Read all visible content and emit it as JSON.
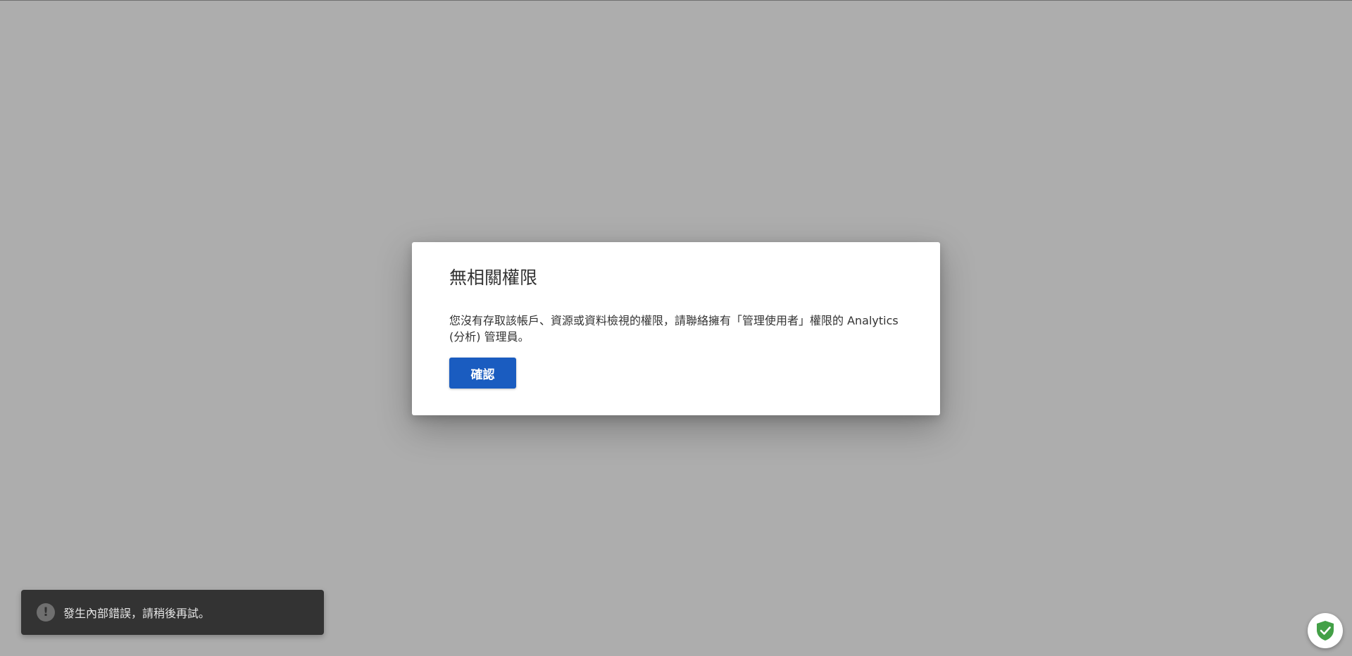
{
  "dialog": {
    "title": "無相關權限",
    "message": "您沒有存取該帳戶、資源或資料檢視的權限，請聯絡擁有「管理使用者」權限的 Analytics (分析) 管理員。",
    "confirm_label": "確認"
  },
  "snackbar": {
    "icon": "exclamation-icon",
    "icon_glyph": "!",
    "message": "發生內部錯誤，請稍後再試。"
  },
  "badge": {
    "icon": "shield-check-icon",
    "color": "#43a047"
  },
  "colors": {
    "overlay": "#adadad",
    "primary_button": "#1a5cc0",
    "snackbar_bg": "#333333"
  }
}
